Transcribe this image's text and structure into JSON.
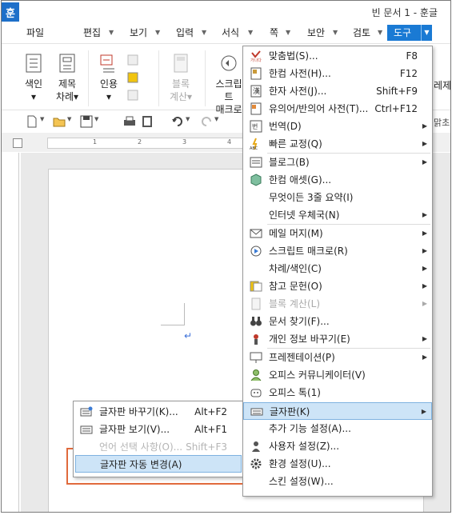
{
  "titlebar": {
    "logo": "훈",
    "title": "빈 문서 1 - 훈글"
  },
  "menubar": {
    "items": [
      {
        "label": "파일"
      },
      {
        "label": "편집"
      },
      {
        "label": "보기"
      },
      {
        "label": "입력"
      },
      {
        "label": "서식"
      },
      {
        "label": "쪽"
      },
      {
        "label": "보안"
      },
      {
        "label": "검토"
      },
      {
        "label": "도구",
        "active": true
      }
    ]
  },
  "ribbon": {
    "buttons": [
      {
        "label1": "색인",
        "label2": "▾"
      },
      {
        "label1": "제목",
        "label2": "차례▾"
      },
      {
        "label1": "인용",
        "label2": "▾"
      },
      {
        "label1": "블록",
        "label2": "계산▾",
        "disabled": true
      },
      {
        "label1": "스크립트",
        "label2": "매크로"
      }
    ],
    "right_partial": "레제"
  },
  "toolbar": {
    "right_partial": "맑초"
  },
  "ruler": {
    "ticks": [
      "1",
      "2",
      "3",
      "4"
    ]
  },
  "dropdown": {
    "items": [
      {
        "icon": "spellcheck-icon",
        "label": "맞춤법(S)...",
        "shortcut": "F8"
      },
      {
        "icon": "dictionary-icon",
        "label": "한컴 사전(H)...",
        "shortcut": "F12"
      },
      {
        "icon": "hanja-dictionary-icon",
        "label": "한자 사전(J)...",
        "shortcut": "Shift+F9"
      },
      {
        "icon": "synonym-dictionary-icon",
        "label": "유의어/반의어 사전(T)...",
        "shortcut": "Ctrl+F12"
      },
      {
        "icon": "translate-icon",
        "label": "번역(D)",
        "submenu": true
      },
      {
        "icon": "quick-correct-icon",
        "label": "빠른 교정(Q)",
        "submenu": true
      },
      {
        "icon": "blog-icon",
        "label": "블로그(B)",
        "submenu": true
      },
      {
        "icon": "hancom-asset-icon",
        "label": "한컴 애셋(G)..."
      },
      {
        "icon": "",
        "label": "무엇이든 3줄 요약(I)"
      },
      {
        "icon": "",
        "label": "인터넷 우체국(N)",
        "submenu": true
      },
      {
        "icon": "mail-merge-icon",
        "label": "메일 머지(M)",
        "submenu": true
      },
      {
        "icon": "script-macro-icon",
        "label": "스크립트 매크로(R)",
        "submenu": true
      },
      {
        "icon": "",
        "label": "차례/색인(C)",
        "submenu": true
      },
      {
        "icon": "references-icon",
        "label": "참고 문헌(O)",
        "submenu": true
      },
      {
        "icon": "block-calc-icon",
        "label": "블록 계산(L)",
        "submenu": true,
        "disabled": true
      },
      {
        "icon": "binoculars-icon",
        "label": "문서 찾기(F)..."
      },
      {
        "icon": "privacy-icon",
        "label": "개인 정보 바꾸기(E)",
        "submenu": true
      },
      {
        "icon": "presentation-icon",
        "label": "프레젠테이션(P)",
        "submenu": true
      },
      {
        "icon": "office-communicator-icon",
        "label": "오피스 커뮤니케이터(V)"
      },
      {
        "icon": "office-talk-icon",
        "label": "오피스 톡(1)"
      },
      {
        "icon": "keyboard-icon",
        "label": "글자판(K)",
        "submenu": true,
        "highlight": true
      },
      {
        "icon": "",
        "label": "추가 기능 설정(A)..."
      },
      {
        "icon": "user-settings-icon",
        "label": "사용자 설정(Z)..."
      },
      {
        "icon": "gear-icon",
        "label": "환경 설정(U)..."
      },
      {
        "icon": "",
        "label": "스킨 설정(W)..."
      }
    ]
  },
  "submenu": {
    "items": [
      {
        "icon": "keyboard-switch-icon",
        "label": "글자판 바꾸기(K)...",
        "shortcut": "Alt+F2"
      },
      {
        "icon": "keyboard-view-icon",
        "label": "글자판 보기(V)...",
        "shortcut": "Alt+F1"
      },
      {
        "icon": "",
        "label": "언어 선택 사항(O)...",
        "shortcut": "Shift+F3",
        "disabled": true
      },
      {
        "icon": "",
        "label": "글자판 자동 변경(A)",
        "highlight": true
      }
    ]
  },
  "colors": {
    "accent": "#1a7ad4",
    "highlight": "#cde4f7",
    "red_box": "#e06a3c"
  }
}
